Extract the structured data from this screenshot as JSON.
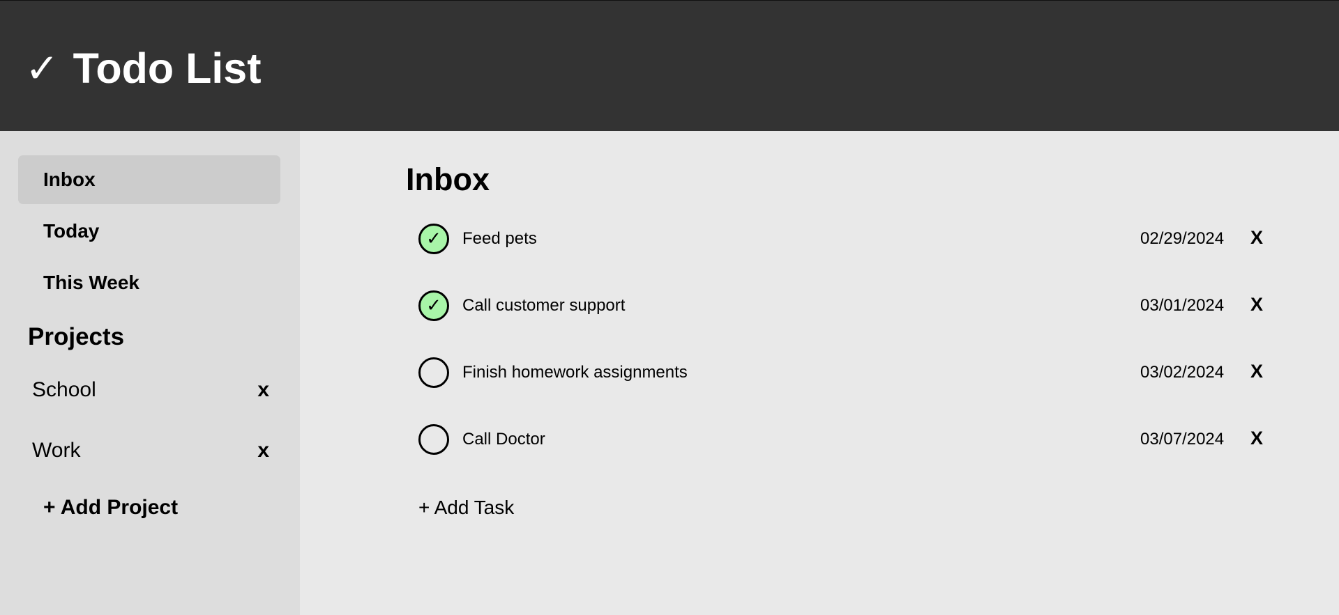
{
  "header": {
    "icon": "checkmark-icon",
    "check_glyph": "✓",
    "title": "Todo List"
  },
  "sidebar": {
    "nav": [
      {
        "label": "Inbox",
        "active": true
      },
      {
        "label": "Today",
        "active": false
      },
      {
        "label": "This Week",
        "active": false
      }
    ],
    "projects_heading": "Projects",
    "projects": [
      {
        "label": "School",
        "delete_label": "x"
      },
      {
        "label": "Work",
        "delete_label": "x"
      }
    ],
    "add_project_label": "+ Add Project"
  },
  "main": {
    "title": "Inbox",
    "tasks": [
      {
        "name": "Feed pets",
        "date": "02/29/2024",
        "done": true,
        "check_glyph": "✓",
        "delete_label": "X"
      },
      {
        "name": "Call customer support",
        "date": "03/01/2024",
        "done": true,
        "check_glyph": "✓",
        "delete_label": "X"
      },
      {
        "name": "Finish homework assignments",
        "date": "03/02/2024",
        "done": false,
        "check_glyph": "",
        "delete_label": "X"
      },
      {
        "name": "Call Doctor",
        "date": "03/07/2024",
        "done": false,
        "check_glyph": "",
        "delete_label": "X"
      }
    ],
    "add_task_label": "+ Add Task"
  },
  "colors": {
    "header_bg": "#333333",
    "sidebar_bg": "#dddddd",
    "main_bg": "#e9e9e9",
    "active_nav_bg": "#cccccc",
    "done_check_bg": "#a8f5a8"
  }
}
